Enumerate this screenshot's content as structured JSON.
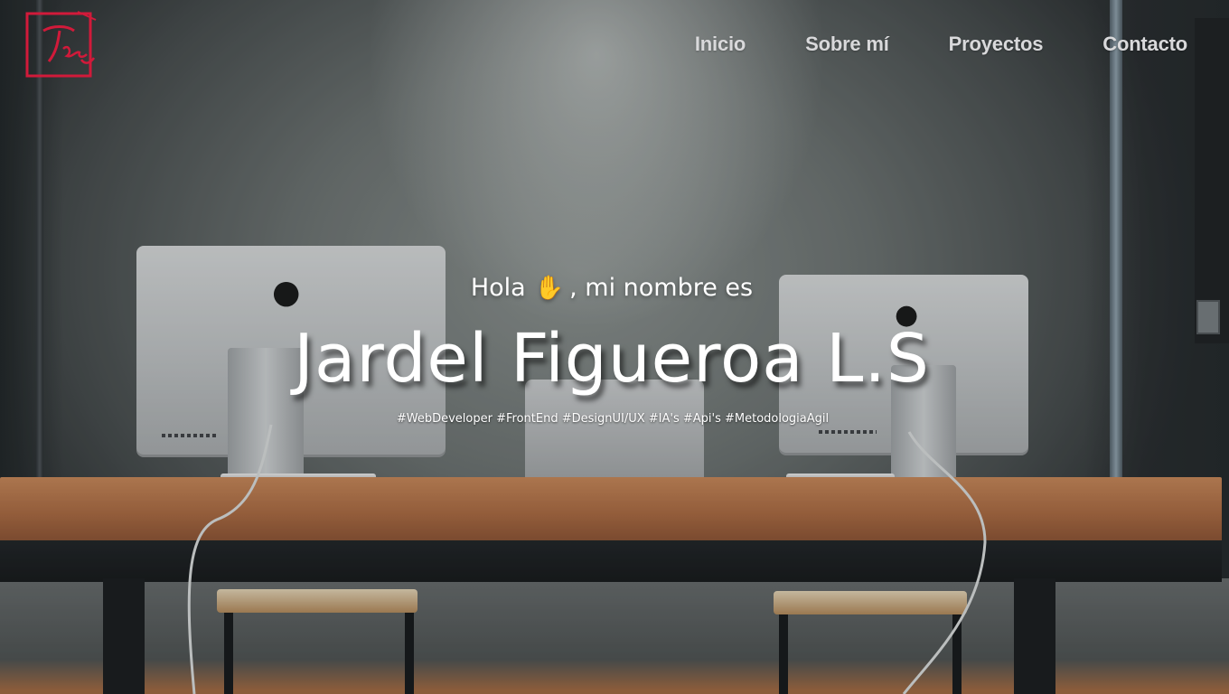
{
  "logo": {
    "text": "JFL",
    "color": "#d11a3a"
  },
  "nav": {
    "items": [
      {
        "label": "Inicio"
      },
      {
        "label": "Sobre mí"
      },
      {
        "label": "Proyectos"
      },
      {
        "label": "Contacto"
      }
    ],
    "color": "#d9d9db"
  },
  "hero": {
    "greeting_before": "Hola",
    "greeting_icon": "raised-hand-icon",
    "greeting_after": ", mi nombre es",
    "name": "Jardel Figueroa L.S",
    "tags": "#WebDeveloper #FrontEnd #DesignUI/UX #IA's #Api's #MetodologiaAgil"
  }
}
